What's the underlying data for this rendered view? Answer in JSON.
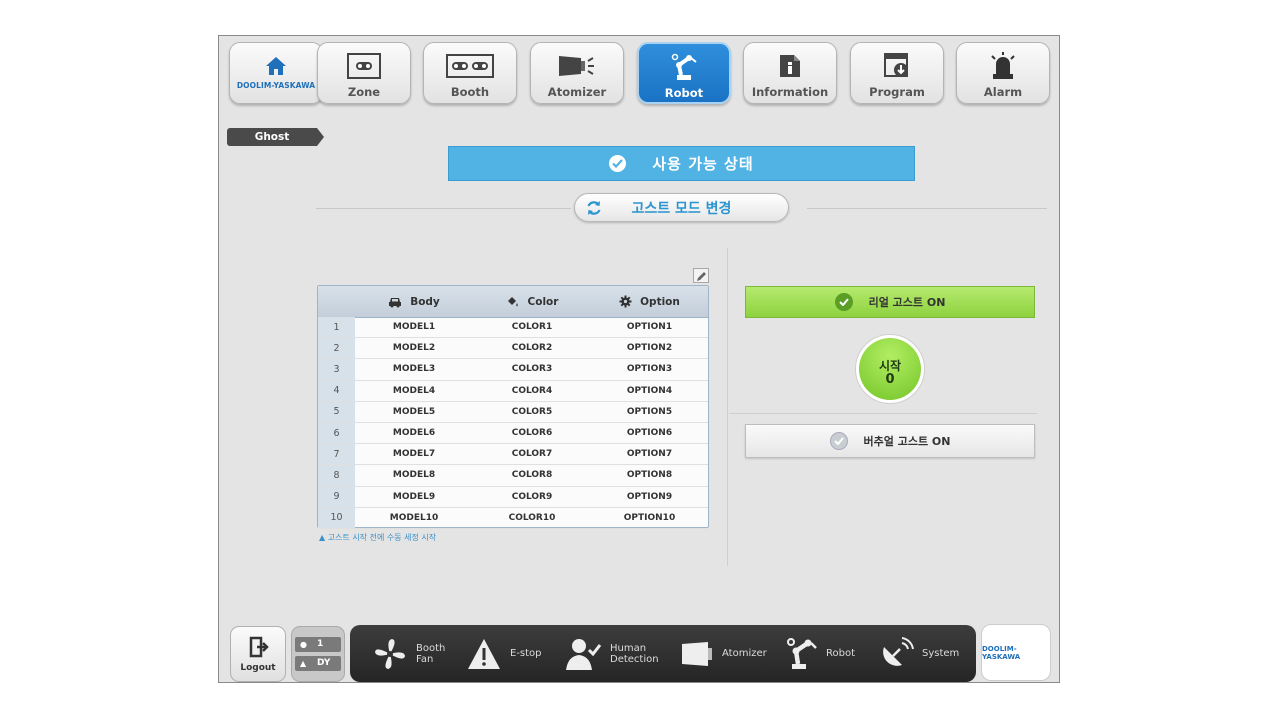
{
  "nav": {
    "home_label": "DOOLIM-YASKAWA",
    "items": [
      {
        "label": "Zone",
        "icon": "zone-icon"
      },
      {
        "label": "Booth",
        "icon": "booth-icon"
      },
      {
        "label": "Atomizer",
        "icon": "atomizer-icon"
      },
      {
        "label": "Robot",
        "icon": "robot-arm-icon",
        "active": true
      },
      {
        "label": "Information",
        "icon": "info-icon"
      },
      {
        "label": "Program",
        "icon": "program-icon"
      },
      {
        "label": "Alarm",
        "icon": "alarm-icon"
      }
    ]
  },
  "page_tag": "Ghost",
  "status": {
    "text": "사용 가능 상태",
    "color": "#50b3e4"
  },
  "mode_button": "고스트 모드 변경",
  "table": {
    "columns": [
      {
        "label": "Body",
        "icon": "car-icon"
      },
      {
        "label": "Color",
        "icon": "paint-bucket-icon"
      },
      {
        "label": "Option",
        "icon": "gear-icon"
      }
    ],
    "rows": [
      {
        "num": "1",
        "body": "MODEL1",
        "color": "COLOR1",
        "option": "OPTION1"
      },
      {
        "num": "2",
        "body": "MODEL2",
        "color": "COLOR2",
        "option": "OPTION2"
      },
      {
        "num": "3",
        "body": "MODEL3",
        "color": "COLOR3",
        "option": "OPTION3"
      },
      {
        "num": "4",
        "body": "MODEL4",
        "color": "COLOR4",
        "option": "OPTION4"
      },
      {
        "num": "5",
        "body": "MODEL5",
        "color": "COLOR5",
        "option": "OPTION5"
      },
      {
        "num": "6",
        "body": "MODEL6",
        "color": "COLOR6",
        "option": "OPTION6"
      },
      {
        "num": "7",
        "body": "MODEL7",
        "color": "COLOR7",
        "option": "OPTION7"
      },
      {
        "num": "8",
        "body": "MODEL8",
        "color": "COLOR8",
        "option": "OPTION8"
      },
      {
        "num": "9",
        "body": "MODEL9",
        "color": "COLOR9",
        "option": "OPTION9"
      },
      {
        "num": "10",
        "body": "MODEL10",
        "color": "COLOR10",
        "option": "OPTION10"
      }
    ],
    "note": "▲ 고스트 시작 전에 수동 세정 시작"
  },
  "real_ghost": {
    "label": "리얼 고스트 ON",
    "color": "#8ed23f"
  },
  "start": {
    "label": "시작",
    "count": "0"
  },
  "virtual_ghost": {
    "label": "버추얼 고스트 ON"
  },
  "bottom": {
    "logout_label": "Logout",
    "user": {
      "id": "1",
      "name": "DY"
    },
    "statuses": [
      {
        "label": "Booth Fan",
        "icon": "fan-icon"
      },
      {
        "label": "E-stop",
        "icon": "warning-icon"
      },
      {
        "label": "Human Detection",
        "icon": "human-detection-icon"
      },
      {
        "label": "Atomizer",
        "icon": "atomizer-icon"
      },
      {
        "label": "Robot",
        "icon": "robot-arm-icon"
      },
      {
        "label": "System",
        "icon": "satellite-dish-icon"
      }
    ],
    "brand": "DOOLIM-YASKAWA"
  }
}
